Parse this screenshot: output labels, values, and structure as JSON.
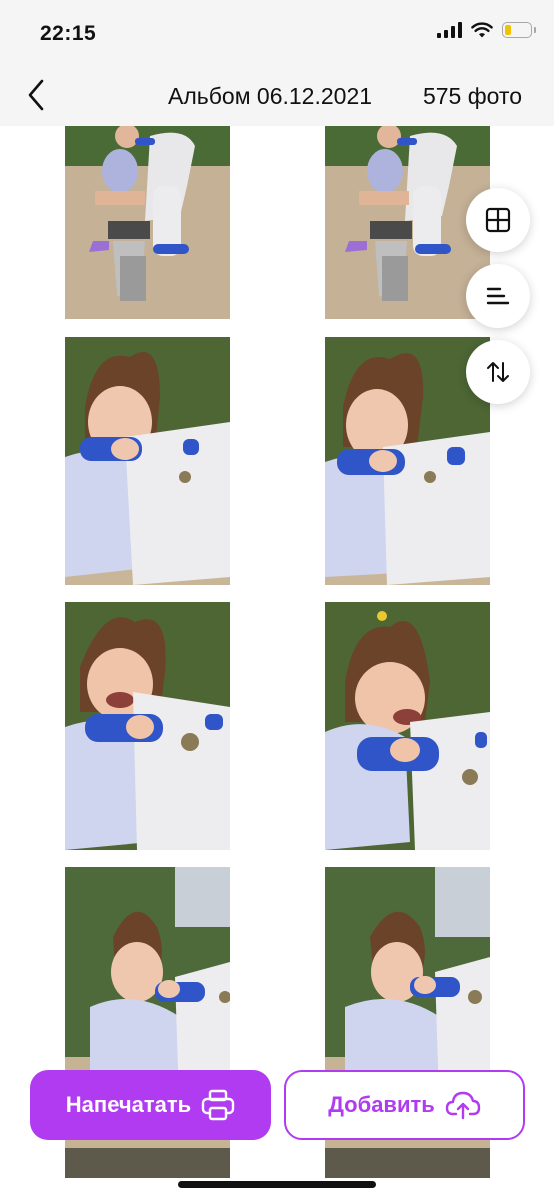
{
  "status_bar": {
    "time": "22:15",
    "icons": [
      "cellular-signal-icon",
      "wifi-icon",
      "battery-icon"
    ],
    "battery_level": 0.25,
    "battery_color": "#f2c200"
  },
  "header": {
    "back_icon": "chevron-left-icon",
    "title": "Альбом 06.12.2021",
    "count": "575 фото"
  },
  "photos": [
    {
      "scene": "rocking-horse-full"
    },
    {
      "scene": "rocking-horse-full"
    },
    {
      "scene": "girl-holding-handle"
    },
    {
      "scene": "girl-holding-handle"
    },
    {
      "scene": "girl-laughing"
    },
    {
      "scene": "girl-laughing"
    },
    {
      "scene": "girl-smiling-wide"
    },
    {
      "scene": "girl-smiling-wide"
    }
  ],
  "floating_buttons": [
    {
      "icon": "grid-view-icon"
    },
    {
      "icon": "align-left-icon"
    },
    {
      "icon": "sort-arrows-icon"
    }
  ],
  "actions": {
    "print_label": "Напечатать",
    "print_icon": "printer-icon",
    "add_label": "Добавить",
    "add_icon": "cloud-upload-icon",
    "accent_color": "#b03bf0"
  }
}
